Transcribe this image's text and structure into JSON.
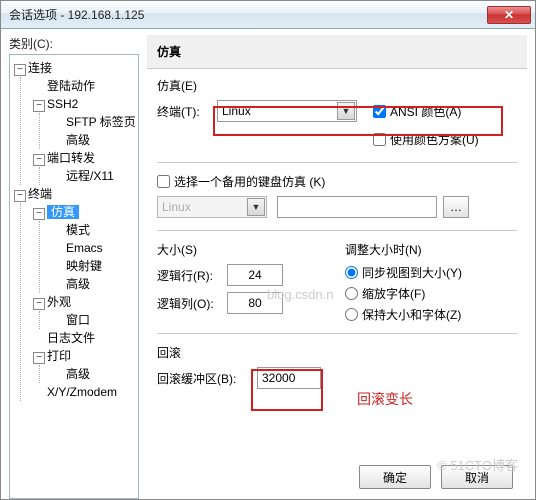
{
  "titlebar": {
    "title": "会话选项 - 192.168.1.125"
  },
  "left": {
    "category_label": "类别(C):",
    "tree": {
      "connection": {
        "label": "连接",
        "logon": "登陆动作",
        "ssh2": {
          "label": "SSH2",
          "sftp": "SFTP 标签页",
          "adv": "高级"
        },
        "portfwd": {
          "label": "端口转发",
          "remote": "远程/X11"
        }
      },
      "terminal": {
        "label": "终端",
        "emu": {
          "label": "仿真",
          "mode": "模式",
          "emacs": "Emacs",
          "map": "映射键",
          "adv": "高级"
        },
        "appear": {
          "label": "外观",
          "win": "窗口"
        },
        "log": "日志文件",
        "print": {
          "label": "打印",
          "adv": "高级"
        },
        "xyz": "X/Y/Zmodem"
      }
    }
  },
  "right": {
    "header": "仿真",
    "emu": {
      "group": "仿真(E)",
      "term_label": "终端(T):",
      "term_value": "Linux",
      "ansi_label": "ANSI 颜色(A)",
      "ansi_checked": true,
      "scheme_label": "使用颜色方案(U)",
      "scheme_checked": false
    },
    "alt": {
      "label": "选择一个备用的键盘仿真 (K)",
      "checked": false,
      "value": "Linux"
    },
    "size": {
      "group": "大小(S)",
      "rows_label": "逻辑行(R):",
      "rows_value": "24",
      "cols_label": "逻辑列(O):",
      "cols_value": "80"
    },
    "resize": {
      "group": "调整大小时(N)",
      "opt1": "同步视图到大小(Y)",
      "opt2": "缩放字体(F)",
      "opt3": "保持大小和字体(Z)"
    },
    "scroll": {
      "group": "回滚",
      "buf_label": "回滚缓冲区(B):",
      "buf_value": "32000"
    },
    "annot": "回滚变长"
  },
  "buttons": {
    "ok": "确定",
    "cancel": "取消"
  },
  "watermark": "blog.csdn.n",
  "bottom_watermark": "© 51CTO博客"
}
